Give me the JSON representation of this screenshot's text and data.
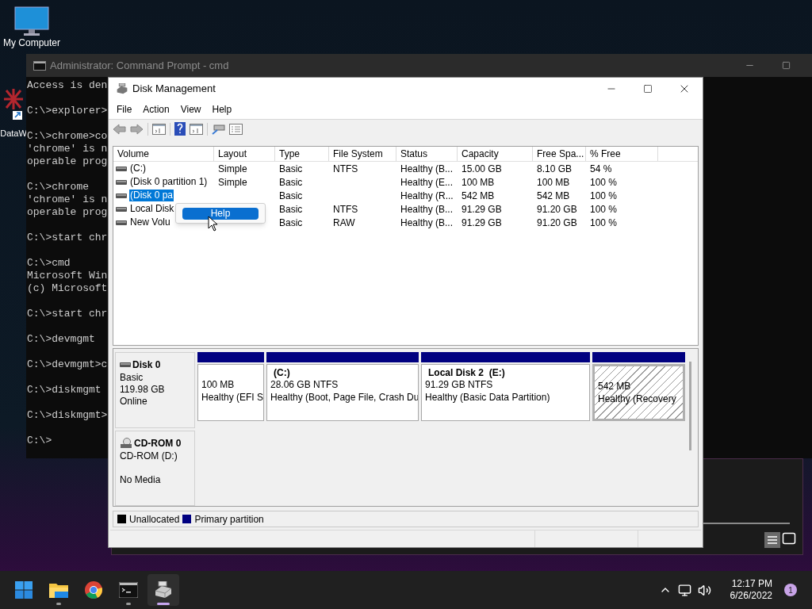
{
  "desktop_icons": [
    {
      "kind": "computer",
      "label": "My Computer"
    },
    {
      "kind": "shortcut",
      "label": "DataW"
    }
  ],
  "cmd_window": {
    "title": "Administrator: Command Prompt - cmd",
    "blocks": [
      [
        "Access is den"
      ],
      [
        "C:\\>explorer>"
      ],
      [
        "C:\\>chrome>co",
        "'chrome' is n",
        "operable prog"
      ],
      [
        "C:\\>chrome",
        "'chrome' is n",
        "operable prog"
      ],
      [
        "C:\\>start chr"
      ],
      [
        "C:\\>cmd",
        "Microsoft Win",
        "(c) Microsoft"
      ],
      [
        "C:\\>start chr"
      ],
      [
        "C:\\>devmgmt"
      ],
      [
        "C:\\>devmgmt>c"
      ],
      [
        "C:\\>diskmgmt"
      ],
      [
        "C:\\>diskmgmt>"
      ],
      [
        "C:\\>"
      ]
    ]
  },
  "disk_management": {
    "title": "Disk Management",
    "menu": [
      "File",
      "Action",
      "View",
      "Help"
    ],
    "volume_list": {
      "columns": [
        "Volume",
        "Layout",
        "Type",
        "File System",
        "Status",
        "Capacity",
        "Free Spa...",
        "% Free"
      ],
      "rows": [
        {
          "volume": "(C:)",
          "layout": "Simple",
          "type": "Basic",
          "file_system": "NTFS",
          "status": "Healthy (B...",
          "capacity": "15.00 GB",
          "free_space": "8.10 GB",
          "percent_free": "54 %",
          "selected": false
        },
        {
          "volume": "(Disk 0 partition 1)",
          "layout": "Simple",
          "type": "Basic",
          "status": "Healthy (E...",
          "capacity": "100 MB",
          "free_space": "100 MB",
          "percent_free": "100 %",
          "selected": false
        },
        {
          "volume": "(Disk 0 pa",
          "type": "Basic",
          "status": "Healthy (R...",
          "capacity": "542 MB",
          "free_space": "542 MB",
          "percent_free": "100 %",
          "selected": true
        },
        {
          "volume": "Local Disk",
          "type": "Basic",
          "file_system": "NTFS",
          "status": "Healthy (B...",
          "capacity": "91.29 GB",
          "free_space": "91.20 GB",
          "percent_free": "100 %",
          "selected": false
        },
        {
          "volume": "New Volu",
          "type": "Basic",
          "file_system": "RAW",
          "status": "Healthy (B...",
          "capacity": "91.29 GB",
          "free_space": "91.20 GB",
          "percent_free": "100 %",
          "selected": false
        }
      ]
    },
    "disks": [
      {
        "kind": "disk",
        "name": "Disk 0",
        "details": [
          "Basic",
          "119.98 GB",
          "Online"
        ],
        "partitions": [
          {
            "size": "100 MB",
            "status": "Healthy (EFI S",
            "selected": false
          },
          {
            "title": "(C:)",
            "size": "28.06 GB NTFS",
            "status": "Healthy (Boot, Page File, Crash Du",
            "selected": false
          },
          {
            "title": "Local Disk 2  (E:)",
            "size": "91.29 GB NTFS",
            "status": "Healthy (Basic Data Partition)",
            "selected": false
          },
          {
            "size": "542 MB",
            "status": "Healthy (Recovery",
            "selected": true
          }
        ]
      },
      {
        "kind": "cdrom",
        "name": "CD-ROM 0",
        "details": [
          "CD-ROM (D:)",
          "No Media"
        ]
      }
    ],
    "legend": [
      {
        "label": "Unallocated",
        "color": "#000000"
      },
      {
        "label": "Primary partition",
        "color": "#000080"
      }
    ]
  },
  "context_menu": {
    "items": [
      {
        "label": "Help",
        "selected": true
      }
    ]
  },
  "taskbar": {
    "apps": [
      {
        "kind": "start",
        "running": false,
        "selected": false
      },
      {
        "kind": "folder",
        "running": true,
        "selected": false
      },
      {
        "kind": "browser",
        "running": false,
        "selected": false
      },
      {
        "kind": "terminal",
        "running": true,
        "selected": false
      },
      {
        "kind": "disk",
        "running": true,
        "selected": true
      }
    ],
    "time": "12:17 PM",
    "date": "6/26/2022",
    "notifications": "1"
  }
}
